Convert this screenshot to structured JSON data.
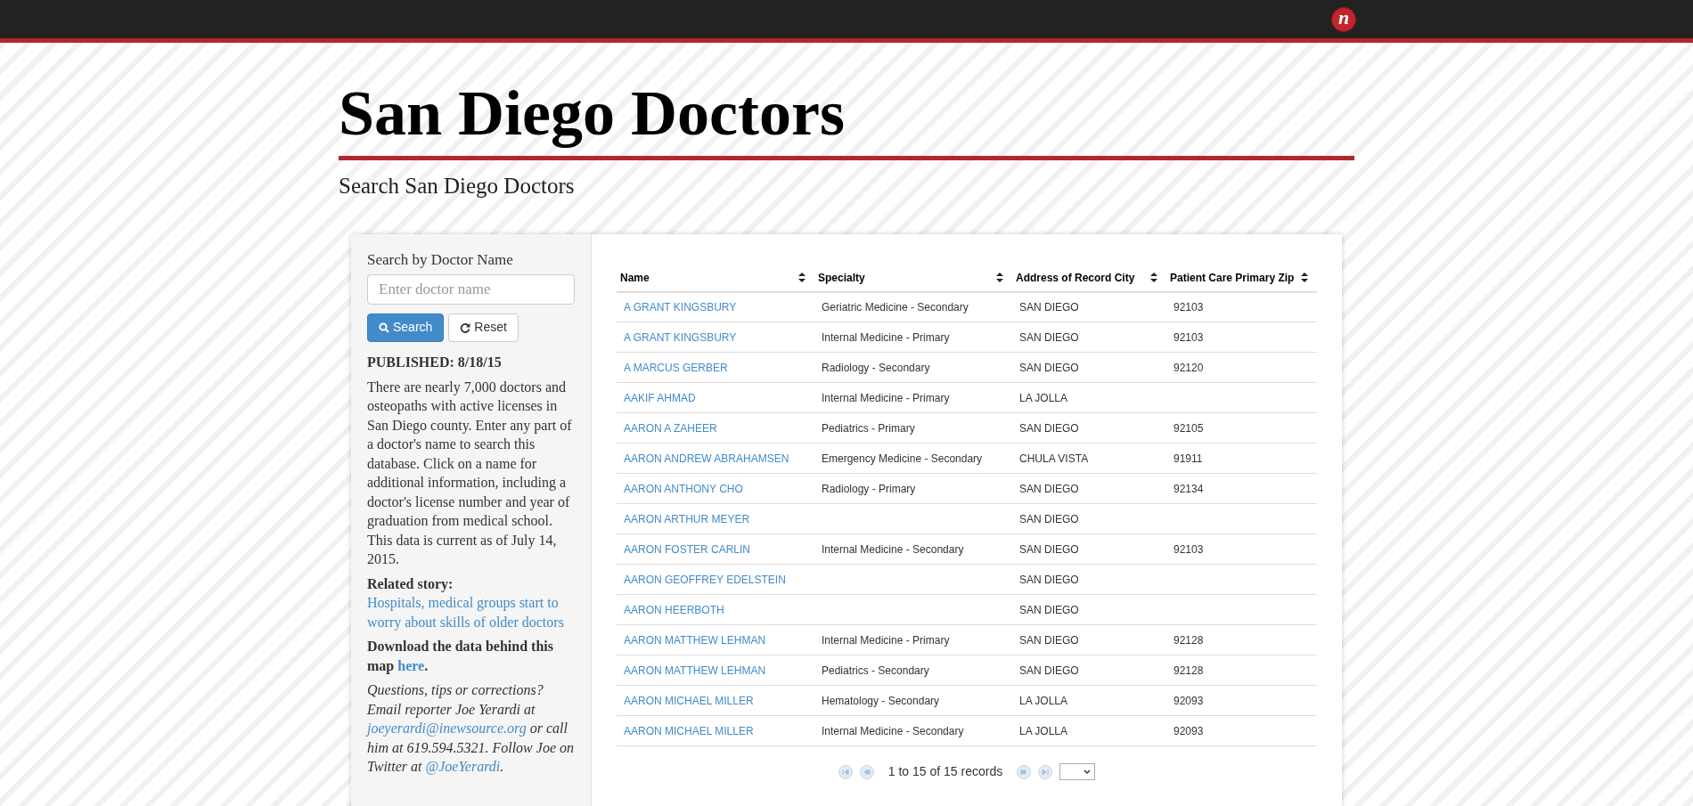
{
  "topbar": {
    "logo_letter": "n"
  },
  "title": "San Diego Doctors",
  "subtitle": "Search San Diego Doctors",
  "sidebar": {
    "search_label": "Search by Doctor Name",
    "search_placeholder": "Enter doctor name",
    "search_button": "Search",
    "reset_button": "Reset",
    "published": "PUBLISHED: 8/18/15",
    "intro": "There are nearly 7,000 doctors and osteopaths with active licenses in San Diego county. Enter any part of a doctor's name to search this database. Click on a name for additional information, including a doctor's license number and year of graduation from medical school. This data is current as of July 14, 2015.",
    "related_label": "Related story:",
    "related_link": "Hospitals, medical groups start to worry about skills of older doctors",
    "download_text": "Download the data behind this map",
    "download_link": "here",
    "download_end": ".",
    "contact_text": "Questions, tips or corrections? Email reporter Joe Yerardi at",
    "contact_email": "joeyerardi@inewsource.org",
    "contact_text2": "or call him at 619.594.5321. Follow Joe on Twitter at",
    "contact_twitter": "@JoeYerardi",
    "contact_end": "."
  },
  "table": {
    "columns": [
      "Name",
      "Specialty",
      "Address of Record City",
      "Patient Care Primary Zip"
    ],
    "rows": [
      [
        "A GRANT KINGSBURY",
        "Geriatric Medicine - Secondary",
        "SAN DIEGO",
        "92103"
      ],
      [
        "A GRANT KINGSBURY",
        "Internal Medicine - Primary",
        "SAN DIEGO",
        "92103"
      ],
      [
        "A MARCUS GERBER",
        "Radiology - Secondary",
        "SAN DIEGO",
        "92120"
      ],
      [
        "AAKIF AHMAD",
        "Internal Medicine - Primary",
        "LA JOLLA",
        ""
      ],
      [
        "AARON A ZAHEER",
        "Pediatrics - Primary",
        "SAN DIEGO",
        "92105"
      ],
      [
        "AARON ANDREW ABRAHAMSEN",
        "Emergency Medicine - Secondary",
        "CHULA VISTA",
        "91911"
      ],
      [
        "AARON ANTHONY CHO",
        "Radiology - Primary",
        "SAN DIEGO",
        "92134"
      ],
      [
        "AARON ARTHUR MEYER",
        "",
        "SAN DIEGO",
        ""
      ],
      [
        "AARON FOSTER CARLIN",
        "Internal Medicine - Secondary",
        "SAN DIEGO",
        "92103"
      ],
      [
        "AARON GEOFFREY EDELSTEIN",
        "",
        "SAN DIEGO",
        ""
      ],
      [
        "AARON HEERBOTH",
        "",
        "SAN DIEGO",
        ""
      ],
      [
        "AARON MATTHEW LEHMAN",
        "Internal Medicine - Primary",
        "SAN DIEGO",
        "92128"
      ],
      [
        "AARON MATTHEW LEHMAN",
        "Pediatrics - Secondary",
        "SAN DIEGO",
        "92128"
      ],
      [
        "AARON MICHAEL MILLER",
        "Hematology - Secondary",
        "LA JOLLA",
        "92093"
      ],
      [
        "AARON MICHAEL MILLER",
        "Internal Medicine - Secondary",
        "LA JOLLA",
        "92093"
      ]
    ]
  },
  "pagination": {
    "summary": "1 to 15 of 15 records"
  }
}
